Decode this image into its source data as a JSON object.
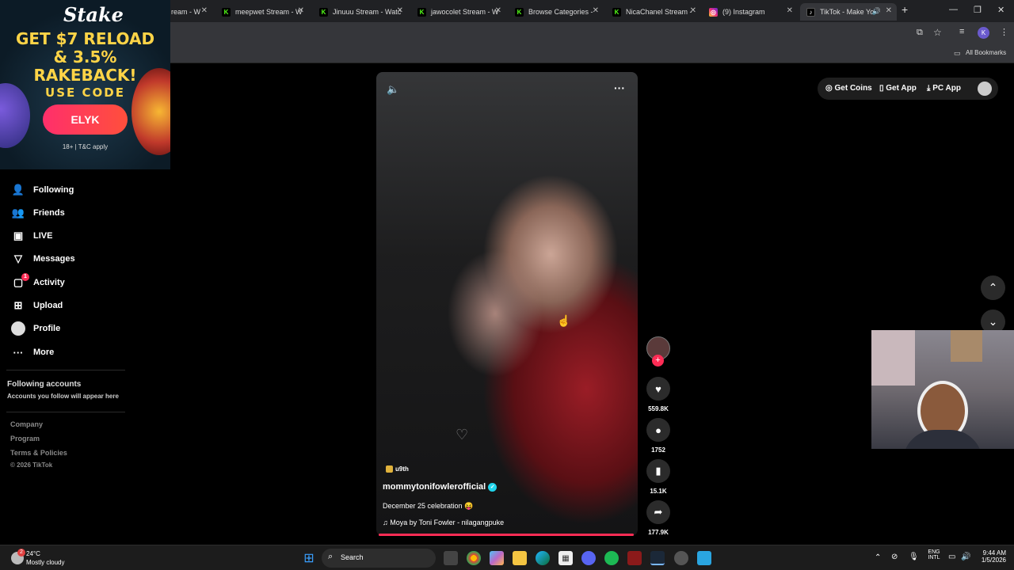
{
  "browser": {
    "tabs": [
      {
        "title": "ream - W",
        "icon": "kick-icon"
      },
      {
        "title": "meepwet Stream - W",
        "icon": "kick-icon"
      },
      {
        "title": "Jinuuu Stream - Watc",
        "icon": "kick-icon"
      },
      {
        "title": "jawocolet Stream - W",
        "icon": "kick-icon"
      },
      {
        "title": "Browse Categories - ",
        "icon": "kick-icon"
      },
      {
        "title": "NicaChanel Stream - ",
        "icon": "kick-icon"
      },
      {
        "title": "(9) Instagram",
        "icon": "instagram-icon"
      },
      {
        "title": "TikTok - Make Yo",
        "icon": "tiktok-icon"
      }
    ],
    "new_tab": "+",
    "all_bookmarks": "All Bookmarks",
    "profile_initial": "K"
  },
  "ad": {
    "logo": "Stake",
    "line1": "GET $7 RELOAD",
    "line2": "& 3.5% RAKEBACK!",
    "use_code": "USE CODE",
    "code": "ELYK",
    "terms": "18+ | T&C apply"
  },
  "sidebar": {
    "items": [
      {
        "label": "Following",
        "icon": "following-icon"
      },
      {
        "label": "Friends",
        "icon": "friends-icon"
      },
      {
        "label": "LIVE",
        "icon": "live-icon"
      },
      {
        "label": "Messages",
        "icon": "messages-icon"
      },
      {
        "label": "Activity",
        "icon": "activity-icon",
        "badge": "1"
      },
      {
        "label": "Upload",
        "icon": "upload-icon"
      },
      {
        "label": "Profile",
        "icon": "avatar"
      },
      {
        "label": "More",
        "icon": "more-icon"
      }
    ],
    "following_title": "Following accounts",
    "following_sub": "Accounts you follow will appear here",
    "footer": [
      "Company",
      "Program",
      "Terms & Policies"
    ],
    "copyright": "© 2026 TikTok"
  },
  "header": {
    "get_coins": "Get Coins",
    "get_app": "Get App",
    "pc_app": "PC App"
  },
  "video": {
    "tag": "u9th",
    "username": "mommytonifowlerofficial",
    "caption": "December 25 celebration 😝",
    "music": "Moya by Toni Fowler - nilagangpuke",
    "likes": "559.8K",
    "comments": "1752",
    "saves": "15.1K",
    "shares": "177.9K",
    "progress": 1.0
  },
  "taskbar": {
    "weather_temp": "24°C",
    "weather_desc": "Mostly cloudy",
    "weather_badge": "2",
    "search": "Search",
    "lang1": "ENG",
    "lang2": "INTL",
    "time": "9:44 AM",
    "date": "1/5/2026"
  }
}
